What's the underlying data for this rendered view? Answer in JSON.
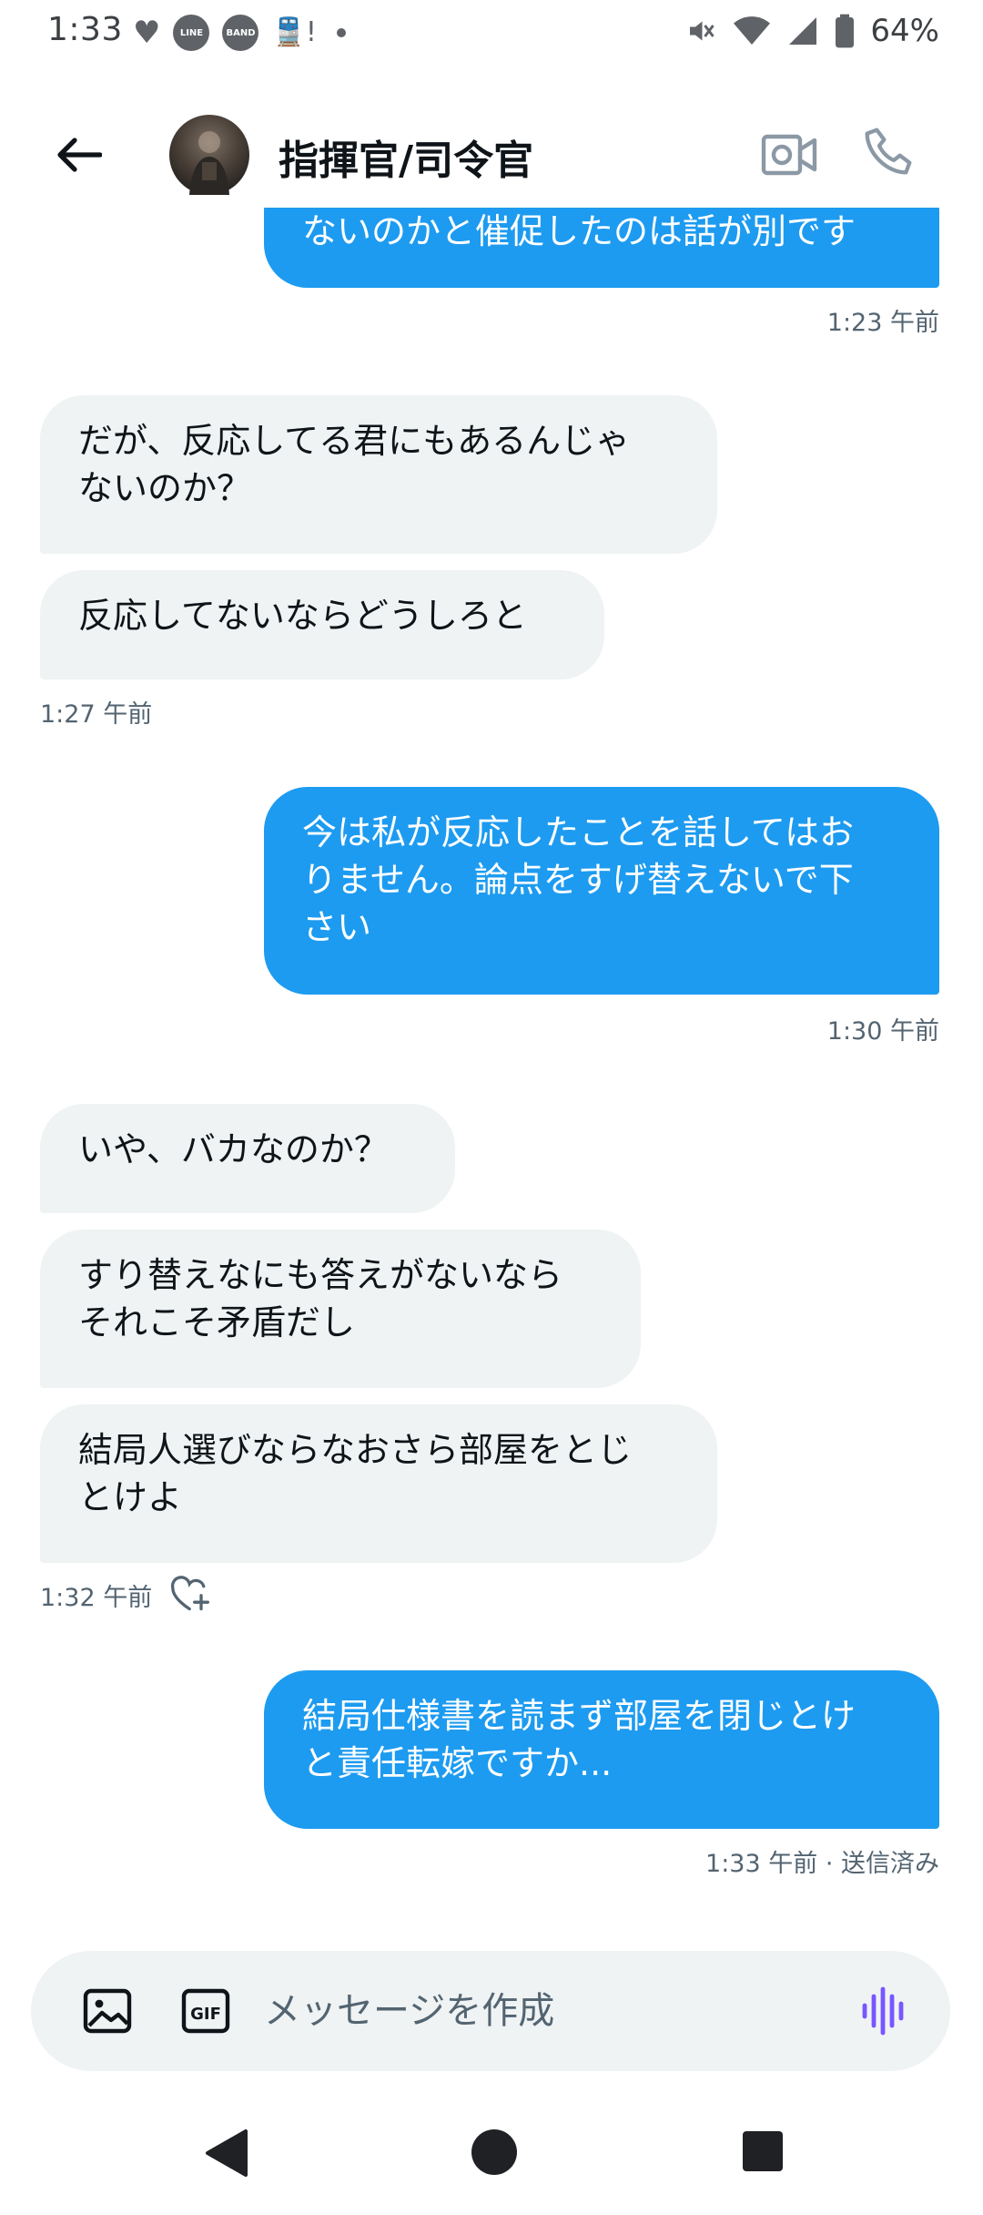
{
  "status_bar": {
    "time": "1:33",
    "notif_line": "LINE",
    "notif_band": "BAND",
    "notif_train": "🚆!",
    "battery": "64%"
  },
  "header": {
    "title": "指揮官/司令官"
  },
  "messages": {
    "m0": {
      "line1": "ないのかと催促したのは話が別です",
      "time": "1:23 午前"
    },
    "m1": {
      "line1": "だが、反応してる君にもあるんじゃ",
      "line2": "ないのか？"
    },
    "m2": {
      "line1": "反応してないならどうしろと",
      "time": "1:27 午前"
    },
    "m3": {
      "line1": "今は私が反応したことを話してはお",
      "line2": "りません。論点をすげ替えないで下",
      "line3": "さい",
      "time": "1:30 午前"
    },
    "m4": {
      "line1": "いや、バカなのか？"
    },
    "m5": {
      "line1": "すり替えなにも答えがないなら",
      "line2": "それこそ矛盾だし"
    },
    "m6": {
      "line1": "結局人選びならなおさら部屋をとじ",
      "line2": "とけよ",
      "time": "1:32 午前"
    },
    "m7": {
      "line1": "結局仕様書を読まず部屋を閉じとけ",
      "line2": "と責任転嫁ですか...",
      "time": "1:33 午前 · 送信済み"
    }
  },
  "composer": {
    "placeholder": "メッセージを作成",
    "gif_label": "GIF"
  },
  "colors": {
    "accent": "#1d9bf0",
    "incoming_bubble": "#eff3f4",
    "muted_text": "#536471",
    "voice_icon": "#7856ff"
  },
  "icons": [
    "back-arrow-icon",
    "video-call-icon",
    "phone-icon",
    "image-icon",
    "gif-icon",
    "voice-icon",
    "add-reaction-icon"
  ]
}
